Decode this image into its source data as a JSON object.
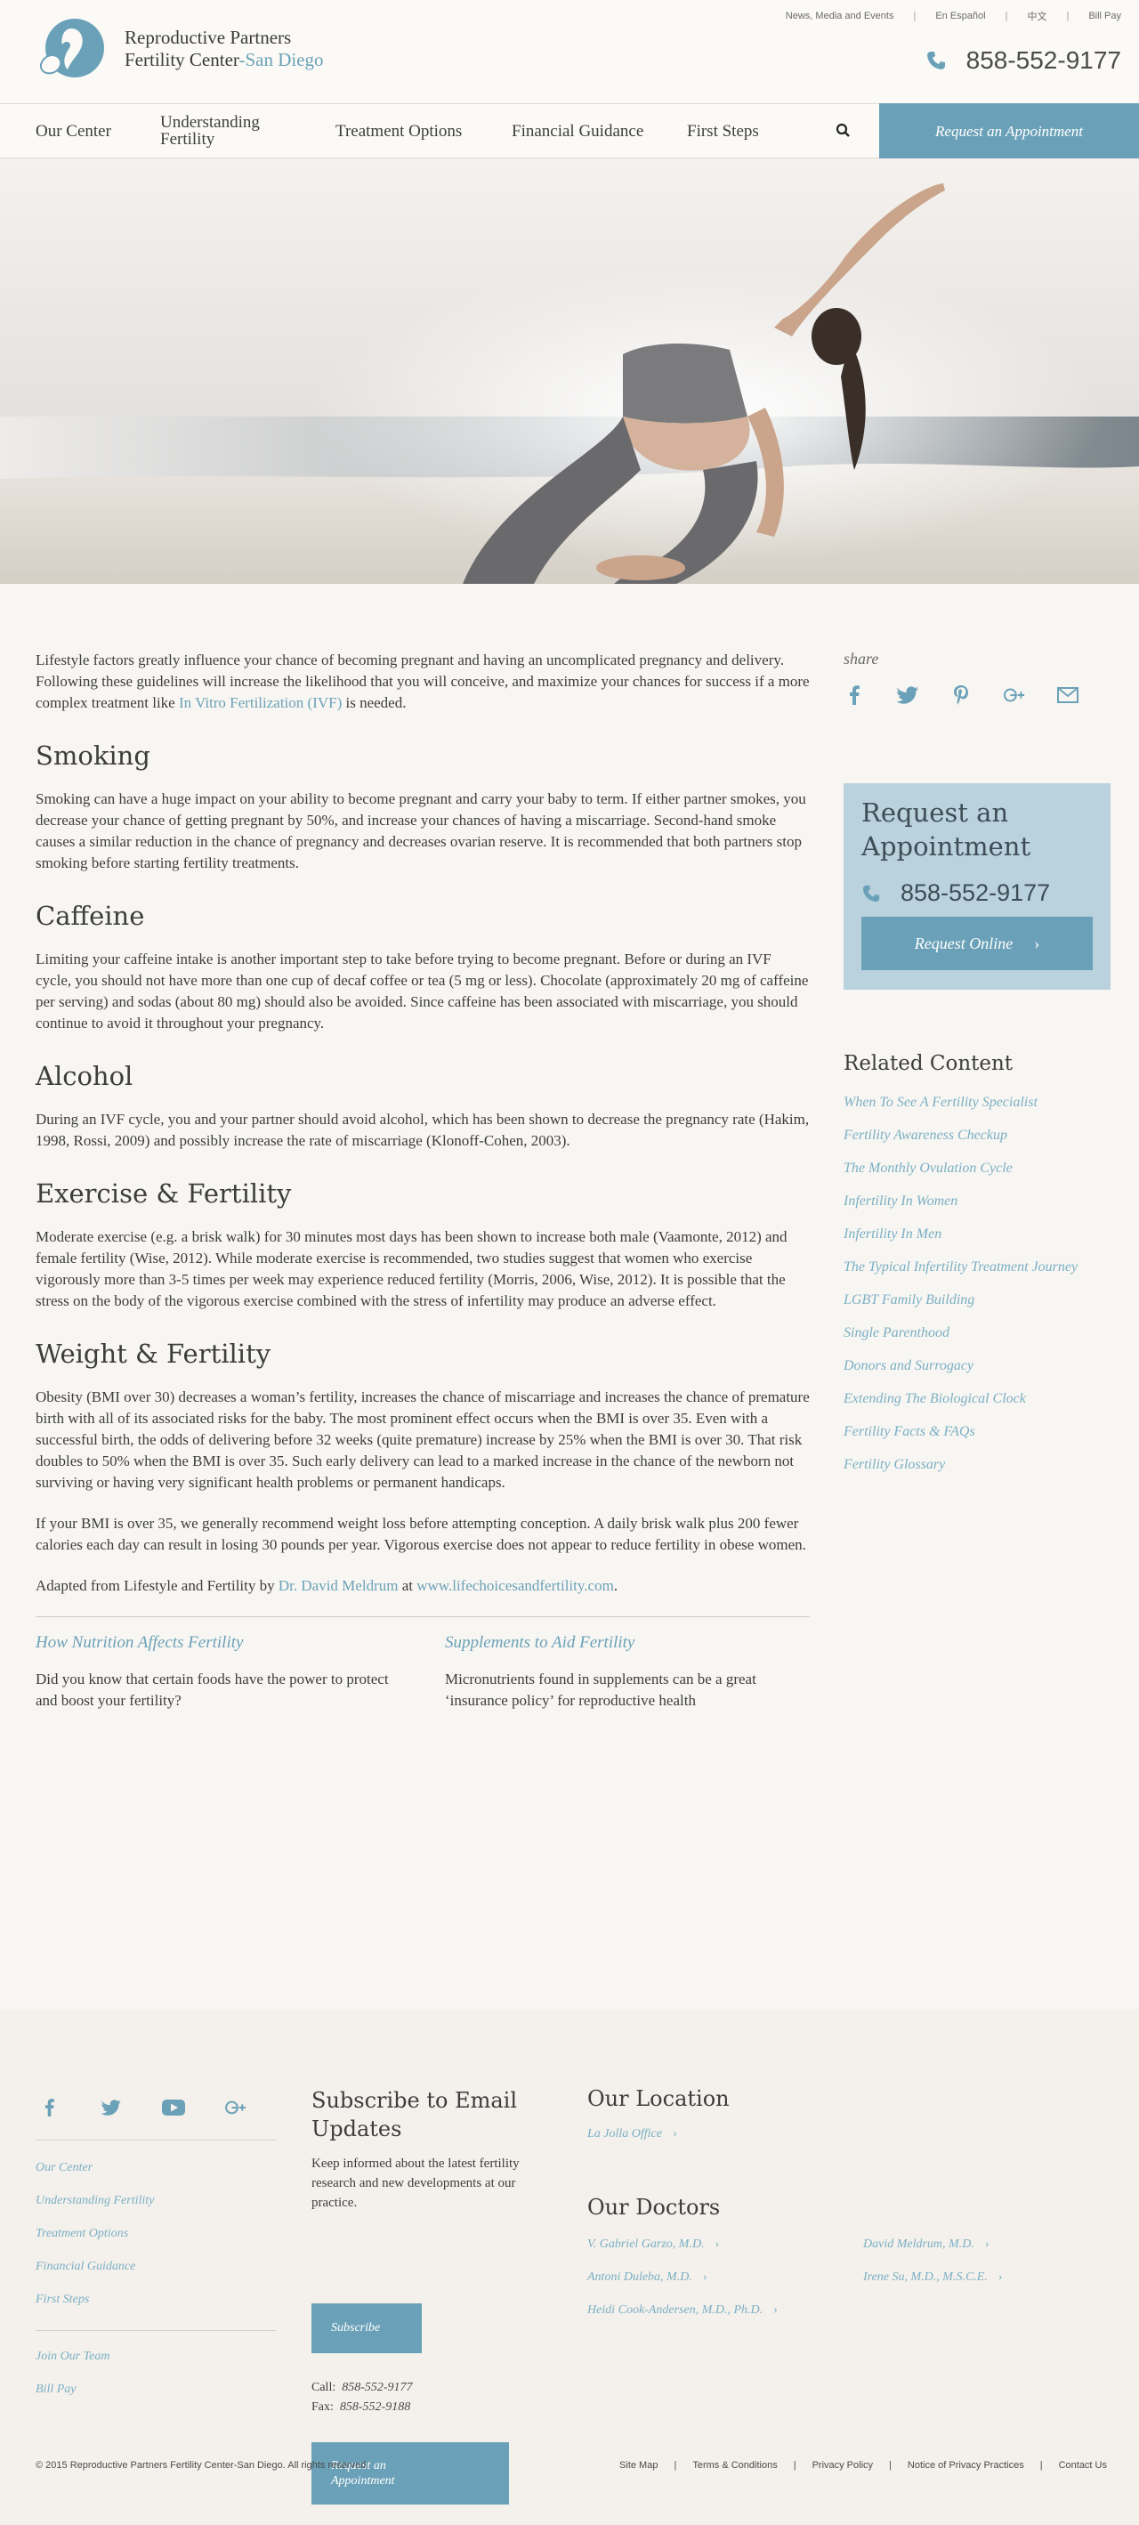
{
  "header": {
    "logo_line1": "Reproductive Partners",
    "logo_line2": "Fertility Center",
    "logo_location": "-San Diego",
    "utility_links": [
      "News, Media and Events",
      "En Español",
      "中文",
      "Bill Pay"
    ],
    "phone": "858-552-9177"
  },
  "nav": {
    "items": [
      "Our Center",
      "Understanding Fertility",
      "Treatment Options",
      "Financial Guidance",
      "First Steps"
    ],
    "cta": "Request an Appointment"
  },
  "content": {
    "intro_before_link": "Lifestyle factors greatly influence your chance of becoming pregnant and having an uncomplicated pregnancy and delivery. Following these guidelines will increase the likelihood that you will conceive, and maximize your chances for success if a more complex treatment like ",
    "intro_link": "In Vitro Fertilization (IVF)",
    "intro_after_link": " is needed.",
    "smoking_title": "Smoking",
    "smoking_text": "Smoking can have a huge impact on your ability to become pregnant and carry your baby to term. If either partner smokes, you decrease your chance of getting pregnant by 50%, and increase your chances of having a miscarriage. Second-hand smoke causes a similar reduction in the chance of pregnancy and decreases ovarian reserve. It is recommended that both partners stop smoking before starting fertility treatments.",
    "caffeine_title": "Caffeine",
    "caffeine_text": "Limiting your caffeine intake is another important step to take before trying to become pregnant. Before or during an IVF cycle, you should not have more than one cup of decaf coffee or tea (5 mg or less). Chocolate (approximately 20 mg of caffeine per serving) and sodas (about 80 mg) should also be avoided. Since caffeine has been associated with miscarriage, you should continue to avoid it throughout your pregnancy.",
    "alcohol_title": "Alcohol",
    "alcohol_text": "During an IVF cycle, you and your partner should avoid alcohol, which has been shown to decrease the pregnancy rate (Hakim, 1998, Rossi, 2009) and possibly increase the rate of miscarriage (Klonoff-Cohen, 2003).",
    "exercise_title": "Exercise & Fertility",
    "exercise_text": "Moderate exercise (e.g. a brisk walk) for 30 minutes most days has been shown to increase both male (Vaamonte, 2012) and female fertility (Wise, 2012). While moderate exercise is recommended, two studies suggest that women who exercise vigorously more than 3-5 times per week may experience reduced fertility (Morris, 2006, Wise, 2012). It is possible that the stress on the body of the vigorous exercise combined with the stress of infertility may produce an adverse effect.",
    "weight_title": "Weight & Fertility",
    "weight_text1": "Obesity (BMI over 30) decreases a woman’s fertility, increases the chance of miscarriage and increases the chance of premature birth with all of its associated risks for the baby. The most prominent effect occurs when the BMI is over 35. Even with a successful birth, the odds of delivering before 32 weeks (quite premature) increase by 25% when the BMI is over 30. That risk doubles to 50% when the BMI is over 35. Such early delivery can lead to a marked increase in the chance of the newborn not surviving or having very significant health problems or permanent handicaps.",
    "weight_text2": "If your BMI is over 35, we generally recommend weight loss before attempting conception. A daily brisk walk plus 200 fewer calories each day can result in losing 30 pounds per year. Vigorous exercise does not appear to reduce fertility in obese women.",
    "adapted_prefix": "Adapted from Lifestyle and Fertility by ",
    "adapted_author": "Dr. David Meldrum",
    "adapted_mid": " at ",
    "adapted_site": "www.lifechoicesandfertility.com",
    "adapted_suffix": ".",
    "related": [
      {
        "title": "How Nutrition Affects Fertility",
        "desc": "Did you know that certain foods have the power to protect and boost your fertility?"
      },
      {
        "title": "Supplements to Aid Fertility",
        "desc": "Micronutrients found in supplements can be a great ‘insurance policy’ for reproductive health"
      }
    ]
  },
  "sidebar": {
    "share_label": "share",
    "share_icons": [
      "facebook-icon",
      "twitter-icon",
      "pinterest-icon",
      "google-plus-icon",
      "email-icon"
    ],
    "appt_title": "Request an Appointment",
    "appt_phone": "858-552-9177",
    "appt_button": "Request Online",
    "related_title": "Related Content",
    "related_links": [
      "When To See A Fertility Specialist",
      "Fertility Awareness Checkup",
      "The Monthly Ovulation Cycle",
      "Infertility In Women",
      "Infertility In Men",
      "The Typical Infertility Treatment Journey",
      "LGBT Family Building",
      "Single Parenthood",
      "Donors and Surrogacy",
      "Extending The Biological Clock",
      "Fertility Facts & FAQs",
      "Fertility Glossary"
    ]
  },
  "footer": {
    "nav": [
      "Our Center",
      "Understanding Fertility",
      "Treatment Options",
      "Financial Guidance",
      "First Steps"
    ],
    "nav2": [
      "Join Our Team",
      "Bill Pay"
    ],
    "subscribe_title": "Subscribe to Email Updates",
    "subscribe_text": "Keep informed about the latest fertility research and new developments at our practice.",
    "subscribe_button": "Subscribe",
    "call_label": "Call:",
    "call_number": "858-552-9177",
    "fax_label": "Fax:",
    "fax_number": "858-552-9188",
    "appt_button": "Request an Appointment",
    "location_title": "Our Location",
    "location_link": "La Jolla Office",
    "doctors_title": "Our Doctors",
    "doctors": [
      "V. Gabriel Garzo, M.D.",
      "David Meldrum, M.D.",
      "Antoni Duleba, M.D.",
      "Irene Su, M.D., M.S.C.E.",
      "Heidi Cook-Andersen, M.D., Ph.D."
    ],
    "copyright": "© 2015 Reproductive Partners Fertility Center-San Diego. All rights reserved.",
    "bottom_links": [
      "Site Map",
      "Terms & Conditions",
      "Privacy Policy",
      "Notice of Privacy Practices",
      "Contact Us"
    ]
  },
  "colors": {
    "accent": "#6ba1b8",
    "link": "#7aafc4",
    "appt_box": "#b9d2dd",
    "background": "#f8f6f2"
  }
}
